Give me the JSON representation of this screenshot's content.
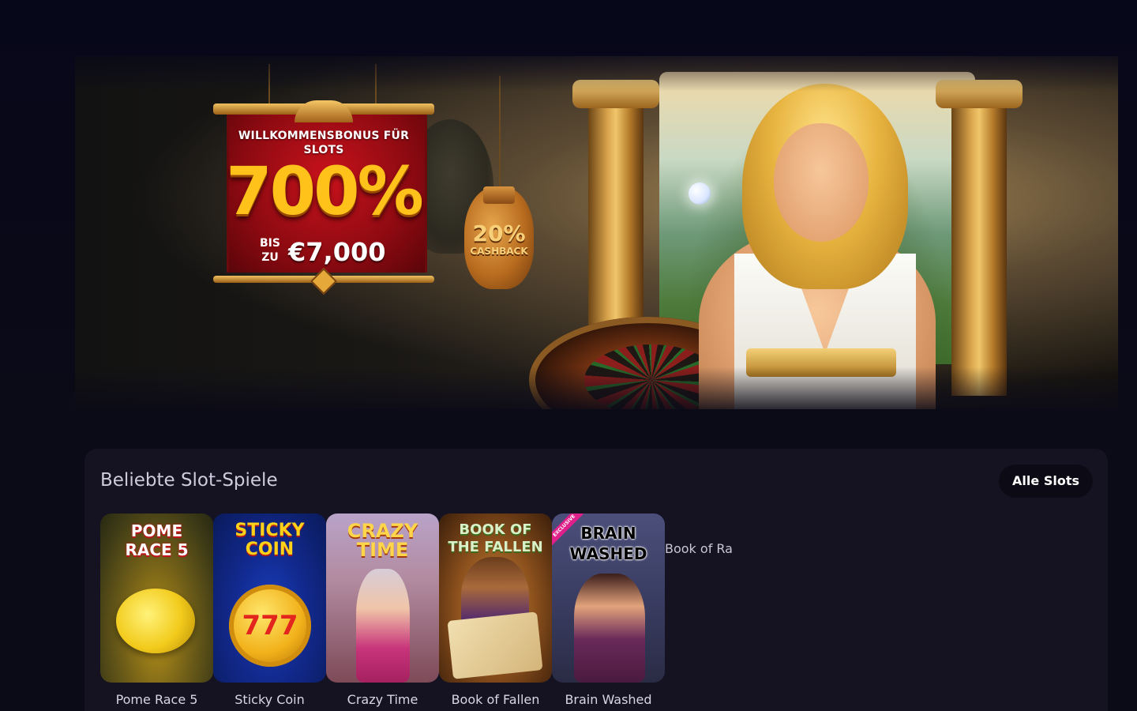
{
  "hero": {
    "bonus_title": "WILLKOMMENSBONUS FÜR SLOTS",
    "bonus_percent": "700%",
    "bonus_prefix_line1": "BIS",
    "bonus_prefix_line2": "ZU",
    "bonus_amount": "€7,000",
    "cashback_percent": "20%",
    "cashback_label": "CASHBACK"
  },
  "slots": {
    "title": "Beliebte Slot-Spiele",
    "all_button": "Alle Slots",
    "games": [
      {
        "name": "Pome Race 5",
        "logo": "POME RACE 5"
      },
      {
        "name": "Sticky Coin",
        "logo": "STICKY COIN",
        "sub": "777"
      },
      {
        "name": "Crazy Time",
        "logo": "CRAZY TIME"
      },
      {
        "name": "Book of Fallen",
        "logo": "BOOK OF THE FALLEN"
      },
      {
        "name": "Brain Washed",
        "logo": "BRAIN WASHED",
        "badge": "EXCLUSIVE"
      }
    ],
    "broken_image_alt": "Book of Ra"
  },
  "colors": {
    "page_bg": "#0b0a17",
    "section_bg": "#151322",
    "button_bg": "#0c0b15",
    "bonus_gold": "#ffc21a",
    "bonus_red": "#c8121c"
  }
}
